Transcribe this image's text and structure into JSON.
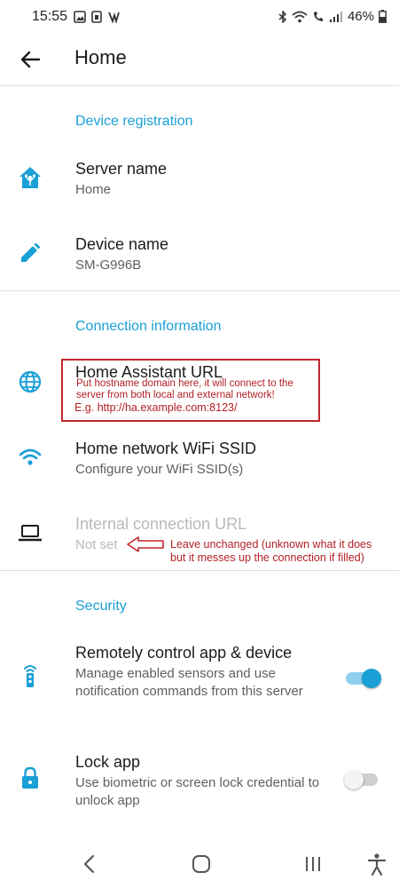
{
  "status": {
    "time": "15:55",
    "battery": "46%"
  },
  "toolbar": {
    "title": "Home"
  },
  "sections": {
    "registration": "Device registration",
    "connection": "Connection information",
    "security": "Security"
  },
  "prefs": {
    "server_name": {
      "title": "Server name",
      "summary": "Home",
      "icon": "home-assistant-icon"
    },
    "device_name": {
      "title": "Device name",
      "summary": "SM-G996B",
      "icon": "pencil-icon"
    },
    "ha_url": {
      "title": "Home Assistant URL",
      "icon": "globe-icon"
    },
    "wifi_ssid": {
      "title": "Home network WiFi SSID",
      "summary": "Configure your WiFi SSID(s)",
      "icon": "wifi-icon"
    },
    "internal_url": {
      "title": "Internal connection URL",
      "summary": "Not set",
      "icon": "laptop-icon"
    },
    "remote_control": {
      "title": "Remotely control app & device",
      "summary": "Manage enabled sensors and use notification commands from this server",
      "icon": "remote-icon",
      "enabled": true
    },
    "lock_app": {
      "title": "Lock app",
      "summary": "Use biometric or screen lock credential to unlock app",
      "icon": "lock-icon",
      "enabled": false
    }
  },
  "annotations": {
    "hostname_line1": "Put hostname domain here, it will connect to the",
    "hostname_line2": "server from both local and external network!",
    "example": "E.g. http://ha.example.com:8123/",
    "leave_line1": "Leave unchanged (unknown what it does",
    "leave_line2": "but it messes up the connection if filled)"
  },
  "colors": {
    "accent": "#1a9fd6",
    "annotation": "#c0282d"
  }
}
